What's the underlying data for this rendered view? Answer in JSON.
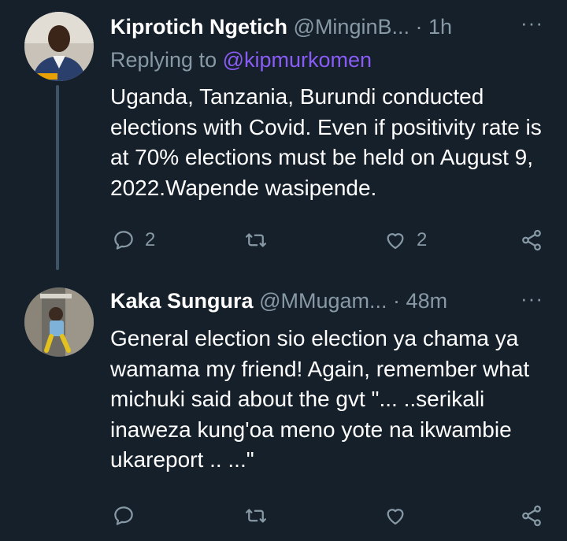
{
  "tweets": [
    {
      "name": "Kiprotich Ngetich",
      "handle": "@MinginB...",
      "separator": "·",
      "time": "1h",
      "replying_prefix": "Replying to",
      "replying_to": "@kipmurkomen",
      "text": "Uganda, Tanzania, Burundi conducted elections with Covid. Even if positivity rate is at 70% elections must be held on August 9, 2022.Wapende wasipende.",
      "reply_count": "2",
      "retweet_count": "",
      "like_count": "2",
      "more_label": "···"
    },
    {
      "name": "Kaka Sungura",
      "handle": "@MMugam...",
      "separator": "·",
      "time": "48m",
      "text": "General election sio election ya chama ya wamama my friend! Again, remember what michuki said about the gvt \"... ..serikali inaweza kung'oa meno yote na ikwambie ukareport .. ...\"",
      "reply_count": "",
      "retweet_count": "",
      "like_count": "",
      "more_label": "···"
    }
  ],
  "icons": {
    "reply": "reply-icon",
    "retweet": "retweet-icon",
    "like": "heart-icon",
    "share": "share-icon",
    "more": "more-icon"
  },
  "colors": {
    "background": "#15202b",
    "secondary_text": "#8899a6",
    "mention": "#8a5cf6",
    "thread_line": "#3d5466"
  }
}
